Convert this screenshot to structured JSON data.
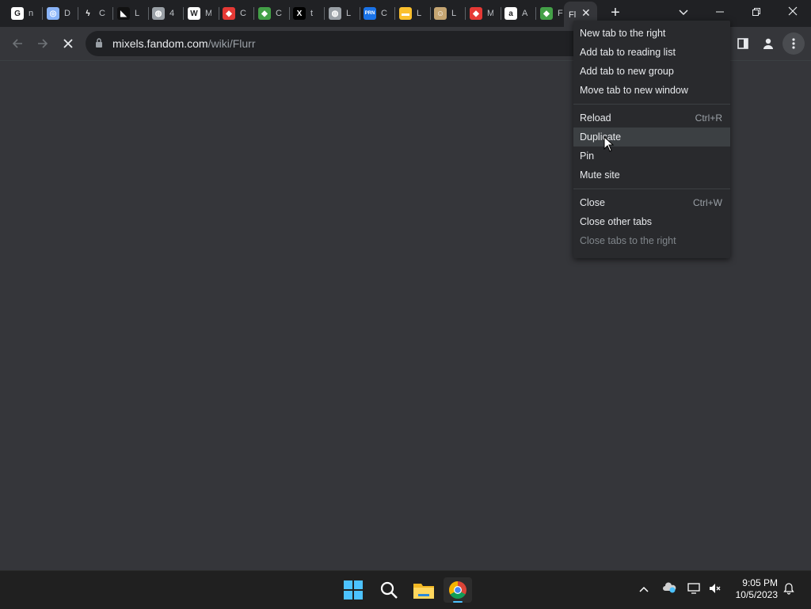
{
  "tabs": [
    {
      "label": "n",
      "icon": "google-icon",
      "color": "#ffffff",
      "glyph": "G"
    },
    {
      "label": "D",
      "icon": "circle-logo-icon",
      "color": "#8ab4f8",
      "glyph": "◎"
    },
    {
      "label": "C",
      "icon": "lightning-icon",
      "color": "#202124",
      "glyph": "ϟ"
    },
    {
      "label": "L",
      "icon": "dark-logo-icon",
      "color": "#111111",
      "glyph": "◣"
    },
    {
      "label": "4",
      "icon": "globe-icon",
      "color": "#9aa0a6",
      "glyph": "◍"
    },
    {
      "label": "M",
      "icon": "wikipedia-icon",
      "color": "#ffffff",
      "glyph": "W"
    },
    {
      "label": "C",
      "icon": "colorful-logo-icon",
      "color": "#e53935",
      "glyph": "◆"
    },
    {
      "label": "C",
      "icon": "colorful-logo-icon",
      "color": "#43a047",
      "glyph": "◆"
    },
    {
      "label": "t",
      "icon": "x-logo-icon",
      "color": "#000000",
      "glyph": "X"
    },
    {
      "label": "L",
      "icon": "globe-icon",
      "color": "#9aa0a6",
      "glyph": "◍"
    },
    {
      "label": "C",
      "icon": "prn-icon",
      "color": "#1a73e8",
      "glyph": "PRN"
    },
    {
      "label": "L",
      "icon": "flag-icon",
      "color": "#fbc02d",
      "glyph": "▬"
    },
    {
      "label": "L",
      "icon": "character-icon",
      "color": "#c5a572",
      "glyph": "☺"
    },
    {
      "label": "M",
      "icon": "colorful-logo-icon",
      "color": "#e53935",
      "glyph": "◆"
    },
    {
      "label": "A",
      "icon": "amazon-icon",
      "color": "#ffffff",
      "glyph": "a"
    },
    {
      "label": "F",
      "icon": "colorful-logo-icon",
      "color": "#43a047",
      "glyph": "◆"
    }
  ],
  "active_tab": {
    "label": "Fl"
  },
  "address": {
    "host": "mixels.fandom.com",
    "path": "/wiki/Flurr"
  },
  "context_menu": {
    "group1": [
      "New tab to the right",
      "Add tab to reading list",
      "Add tab to new group",
      "Move tab to new window"
    ],
    "reload": {
      "label": "Reload",
      "shortcut": "Ctrl+R"
    },
    "duplicate": "Duplicate",
    "pin": "Pin",
    "mute": "Mute site",
    "close": {
      "label": "Close",
      "shortcut": "Ctrl+W"
    },
    "close_other": "Close other tabs",
    "close_right": "Close tabs to the right"
  },
  "taskbar": {
    "time": "9:05 PM",
    "date": "10/5/2023"
  },
  "colors": {
    "accent": "#8ab4f8",
    "tab_strip": "#202124",
    "toolbar": "#35363a",
    "menu": "#292a2d"
  }
}
